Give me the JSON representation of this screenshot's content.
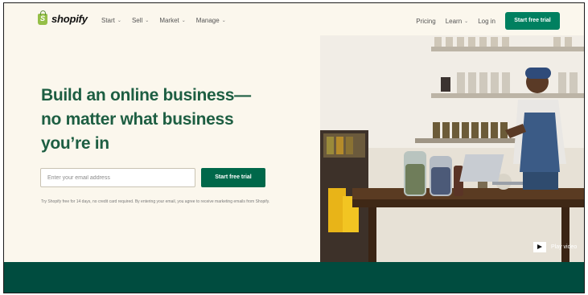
{
  "nav": {
    "logo_text": "shopify",
    "menu": [
      {
        "label": "Start"
      },
      {
        "label": "Sell"
      },
      {
        "label": "Market"
      },
      {
        "label": "Manage"
      }
    ],
    "pricing": "Pricing",
    "learn": "Learn",
    "login": "Log in",
    "cta": "Start free trial"
  },
  "hero": {
    "headline_line1": "Build an online business—",
    "headline_line2": "no matter what business",
    "headline_line3": "you’re in",
    "email_placeholder": "Enter your email address",
    "cta": "Start free trial",
    "disclaimer": "Try Shopify free for 14 days, no credit card required. By entering your email, you agree to receive marketing emails from Shopify."
  },
  "video": {
    "play_label": "Play video"
  },
  "colors": {
    "brand_green": "#008060",
    "headline_green": "#1d5e42",
    "band_green": "#004c3f",
    "background": "#fbf7ed"
  }
}
